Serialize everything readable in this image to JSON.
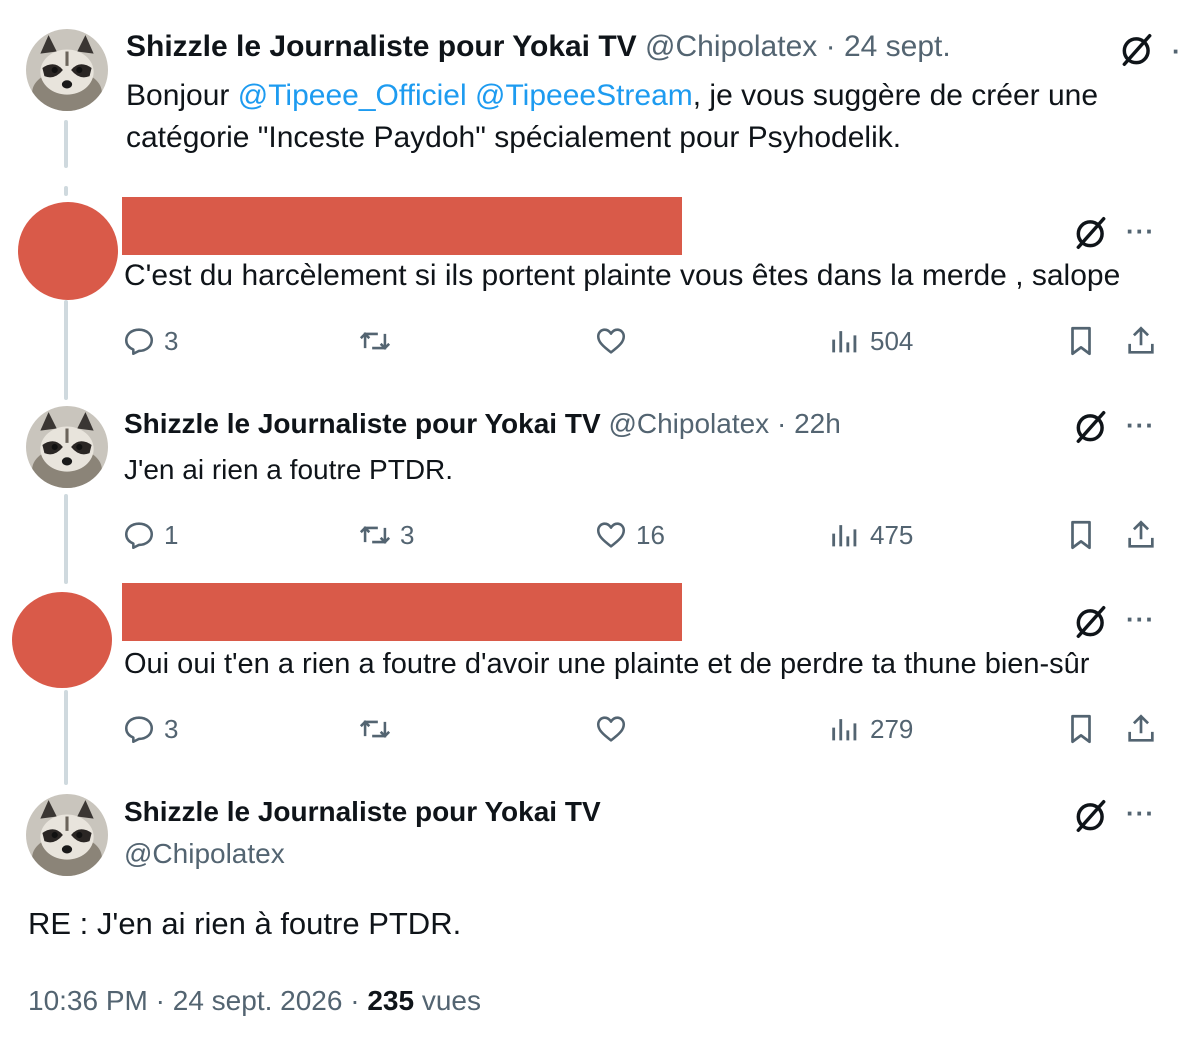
{
  "tweet1": {
    "display_name": "Shizzle le Journaliste pour Yokai TV",
    "handle": "@Chipolatex",
    "sep": " · ",
    "time": "24 sept.",
    "text_before": "Bonjour ",
    "mention1": "@Tipeee_Officiel",
    "mention2": "@TipeeeStream",
    "text_line1_after": ", je vous suggère de créer une",
    "text_line2": "catégorie \"Inceste Paydoh\" spécialement pour Psyhodelik."
  },
  "reply1": {
    "text": "C'est du harcèlement si ils portent plainte vous êtes dans la merde , salope",
    "reply_count": "3",
    "retweet_count": "",
    "like_count": "",
    "views": "504"
  },
  "reply2": {
    "display_name": "Shizzle le Journaliste pour Yokai TV",
    "handle": "@Chipolatex",
    "sep": " · ",
    "time": "22h",
    "text": "J'en ai rien a foutre PTDR.",
    "reply_count": "1",
    "retweet_count": "3",
    "like_count": "16",
    "views": "475"
  },
  "reply3": {
    "text": "Oui oui t'en a rien a foutre d'avoir une plainte et de perdre ta thune bien-sûr",
    "reply_count": "3",
    "retweet_count": "",
    "like_count": "",
    "views": "279"
  },
  "main": {
    "display_name": "Shizzle le Journaliste pour Yokai TV",
    "handle": "@Chipolatex",
    "text": "RE : J'en ai rien à foutre PTDR.",
    "time": "10:36 PM",
    "sep1": " · ",
    "date": "24 sept. 2026",
    "sep2": " · ",
    "views": "235",
    "views_label": " vues"
  },
  "icons": {
    "reply": "reply-icon",
    "retweet": "retweet-icon",
    "like": "heart-icon",
    "views": "views-icon",
    "bookmark": "bookmark-icon",
    "share": "share-icon",
    "grok": "grok-icon",
    "more": "more-icon"
  },
  "colors": {
    "redaction": "#d95a49",
    "link": "#1d9bf0",
    "muted": "#536471",
    "thread_line": "#cfd9de"
  }
}
